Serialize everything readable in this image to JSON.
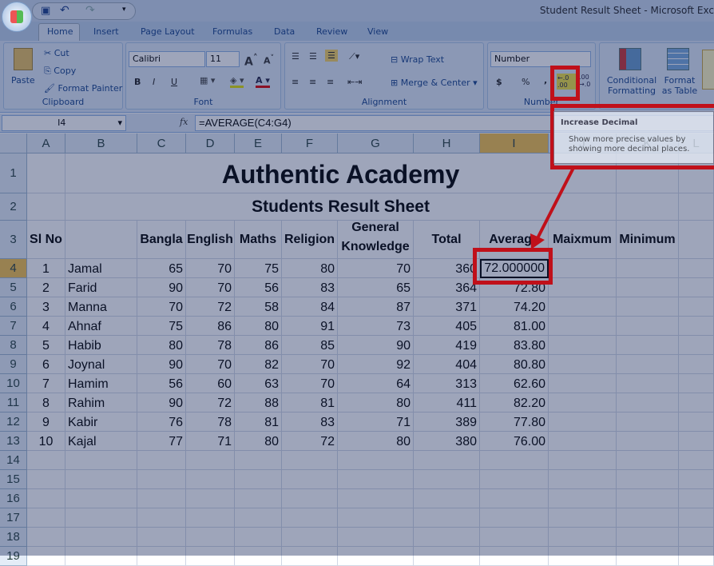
{
  "window": {
    "title": "Student Result Sheet - Microsoft Exc"
  },
  "tabs": [
    "Home",
    "Insert",
    "Page Layout",
    "Formulas",
    "Data",
    "Review",
    "View"
  ],
  "ribbon": {
    "clipboard": {
      "label": "Clipboard",
      "paste": "Paste",
      "cut": "Cut",
      "copy": "Copy",
      "format_painter": "Format Painter"
    },
    "font": {
      "label": "Font",
      "name": "Calibri",
      "size": "11",
      "bold": "B",
      "italic": "I",
      "underline": "U"
    },
    "alignment": {
      "label": "Alignment",
      "wrap_text": "Wrap Text",
      "merge_center": "Merge & Center"
    },
    "number": {
      "label": "Number",
      "format": "Number",
      "currency": "$",
      "percent": "%",
      "comma": ",",
      "increase_decimal": "←.0 .00",
      "decrease_decimal": ".00 →.0"
    },
    "styles": {
      "conditional": "Conditional Formatting",
      "format_table": "Format as Table"
    }
  },
  "formula_bar": {
    "name_box": "I4",
    "fx": "fx",
    "formula": "=AVERAGE(C4:G4)"
  },
  "tooltip": {
    "title": "Increase Decimal",
    "body": "Show more precise values by showing more decimal places."
  },
  "sheet": {
    "columns": [
      "A",
      "B",
      "C",
      "D",
      "E",
      "F",
      "G",
      "H",
      "I",
      "J",
      "K",
      "L"
    ],
    "selected_column": "I",
    "selected_row": "4",
    "selected_cell_value": "72.000000",
    "title": "Authentic Academy",
    "subtitle": "Students Result Sheet",
    "headers": [
      "Sl No",
      "",
      "Bangla",
      "English",
      "Maths",
      "Religion",
      "General Knowledge",
      "Total",
      "Average",
      "Maixmum",
      "Minimum"
    ],
    "rows": [
      [
        "1",
        "Jamal",
        "65",
        "70",
        "75",
        "80",
        "70",
        "360",
        "72.000000"
      ],
      [
        "2",
        "Farid",
        "90",
        "70",
        "56",
        "83",
        "65",
        "364",
        "72.80"
      ],
      [
        "3",
        "Manna",
        "70",
        "72",
        "58",
        "84",
        "87",
        "371",
        "74.20"
      ],
      [
        "4",
        "Ahnaf",
        "75",
        "86",
        "80",
        "91",
        "73",
        "405",
        "81.00"
      ],
      [
        "5",
        "Habib",
        "80",
        "78",
        "86",
        "85",
        "90",
        "419",
        "83.80"
      ],
      [
        "6",
        "Joynal",
        "90",
        "70",
        "82",
        "70",
        "92",
        "404",
        "80.80"
      ],
      [
        "7",
        "Hamim",
        "56",
        "60",
        "63",
        "70",
        "64",
        "313",
        "62.60"
      ],
      [
        "8",
        "Rahim",
        "90",
        "72",
        "88",
        "81",
        "80",
        "411",
        "82.20"
      ],
      [
        "9",
        "Kabir",
        "76",
        "78",
        "81",
        "83",
        "71",
        "389",
        "77.80"
      ],
      [
        "10",
        "Kajal",
        "77",
        "71",
        "80",
        "72",
        "80",
        "380",
        "76.00"
      ]
    ],
    "row_numbers": [
      "1",
      "2",
      "3",
      "4",
      "5",
      "6",
      "7",
      "8",
      "9",
      "10",
      "11",
      "12",
      "13",
      "14",
      "15",
      "16",
      "17",
      "18",
      "19"
    ]
  },
  "colors": {
    "highlight": "#c0101a",
    "ribbon": "#d7e4f4",
    "selected_header": "#f5c14a"
  }
}
